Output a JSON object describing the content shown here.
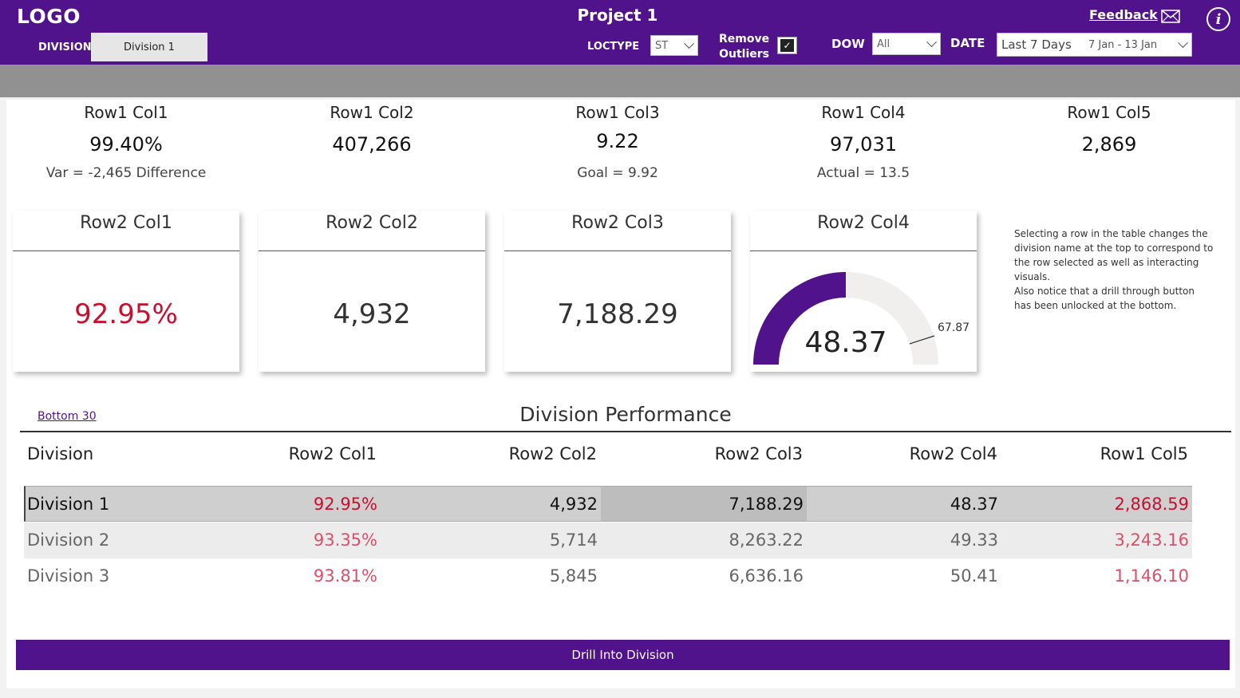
{
  "header": {
    "logo": "LOGO",
    "title": "Project 1",
    "division_label": "DIVISION",
    "division_value": "Division 1",
    "loctype_label": "LOCTYPE",
    "loctype_value": "ST",
    "remove_outliers_label_1": "Remove",
    "remove_outliers_label_2": "Outliers",
    "remove_outliers_checked": true,
    "dow_label": "DOW",
    "dow_value": "All",
    "date_label": "DATE",
    "date_value": "Last 7 Days",
    "date_range": "7 Jan - 13 Jan",
    "feedback": "Feedback",
    "info_icon": "info-icon",
    "mail_icon": "mail-icon"
  },
  "row1": [
    {
      "title": "Row1 Col1",
      "value": "99.40%",
      "sub": "Var = -2,465 Difference"
    },
    {
      "title": "Row1 Col2",
      "value": "407,266",
      "sub": ""
    },
    {
      "title": "Row1 Col3",
      "value": "9.22",
      "sub": "Goal = 9.92"
    },
    {
      "title": "Row1 Col4",
      "value": "97,031",
      "sub": "Actual = 13.5"
    },
    {
      "title": "Row1 Col5",
      "value": "2,869",
      "sub": ""
    }
  ],
  "row2": [
    {
      "title": "Row2 Col1",
      "value": "92.95%"
    },
    {
      "title": "Row2 Col2",
      "value": "4,932"
    },
    {
      "title": "Row2 Col3",
      "value": "7,188.29"
    },
    {
      "title": "Row2 Col4",
      "value": "48.37",
      "target": "67.87"
    }
  ],
  "gauge": {
    "value": 48.37,
    "max": 96.74,
    "target": 67.87
  },
  "note": {
    "line1": "Selecting a row in the table changes the division name at the top to correspond to the row selected as well as interacting visuals.",
    "line2": "Also notice that a drill through button has been unlocked at the bottom."
  },
  "table": {
    "link": "Bottom 30",
    "title": "Division Performance",
    "headers": [
      "Division",
      "Row2 Col1",
      "Row2 Col2",
      "Row2 Col3",
      "Row2 Col4",
      "Row1 Col5"
    ],
    "rows": [
      [
        "Division 1",
        "92.95%",
        "4,932",
        "7,188.29",
        "48.37",
        "2,868.59"
      ],
      [
        "Division 2",
        "93.35%",
        "5,714",
        "8,263.22",
        "49.33",
        "3,243.16"
      ],
      [
        "Division 3",
        "93.81%",
        "5,845",
        "6,636.16",
        "50.41",
        "1,146.10"
      ]
    ]
  },
  "drill_button": "Drill Into Division",
  "colors": {
    "brand": "#51138b",
    "alert": "#c8102e",
    "alert_light": "#d9506a"
  }
}
